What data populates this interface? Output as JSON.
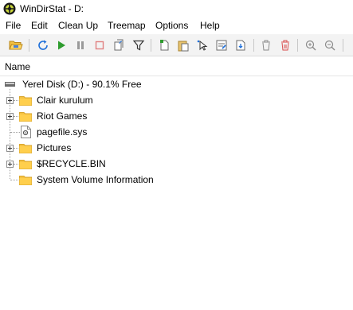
{
  "window": {
    "title": "WinDirStat - D:",
    "icon": "windirstat-logo-icon"
  },
  "menu": {
    "items": [
      {
        "label": "File"
      },
      {
        "label": "Edit"
      },
      {
        "label": "Clean Up"
      },
      {
        "label": "Treemap"
      },
      {
        "label": "Options"
      },
      {
        "label": "Help"
      }
    ]
  },
  "toolbar": {
    "buttons": [
      {
        "icon": "open-folder-icon"
      },
      {
        "icon": "refresh-icon"
      },
      {
        "icon": "play-icon"
      },
      {
        "icon": "pause-icon"
      },
      {
        "icon": "stop-icon"
      },
      {
        "icon": "copy-path-icon"
      },
      {
        "icon": "filter-icon"
      },
      {
        "icon": "new-file-icon"
      },
      {
        "icon": "paste-icon"
      },
      {
        "icon": "select-icon"
      },
      {
        "icon": "edit-properties-icon"
      },
      {
        "icon": "export-icon"
      },
      {
        "icon": "recycle-delete-icon"
      },
      {
        "icon": "delete-icon"
      },
      {
        "icon": "zoom-in-icon"
      },
      {
        "icon": "zoom-out-icon"
      }
    ]
  },
  "columns": {
    "name": "Name"
  },
  "tree": {
    "root": {
      "label": "Yerel Disk (D:) - 90.1% Free",
      "icon": "drive-icon"
    },
    "items": [
      {
        "label": "Clair kurulum",
        "icon": "folder-icon",
        "expandable": true
      },
      {
        "label": "Riot Games",
        "icon": "folder-icon",
        "expandable": true
      },
      {
        "label": "pagefile.sys",
        "icon": "system-file-icon",
        "expandable": false
      },
      {
        "label": "Pictures",
        "icon": "folder-icon",
        "expandable": true
      },
      {
        "label": "$RECYCLE.BIN",
        "icon": "folder-icon",
        "expandable": true
      },
      {
        "label": "System Volume Information",
        "icon": "folder-icon",
        "expandable": false
      }
    ]
  },
  "colors": {
    "folder": "#f5c242",
    "play": "#2e9c2e",
    "stop": "#d94b4b",
    "refresh": "#1e6fd9",
    "delete": "#d94b4b"
  }
}
